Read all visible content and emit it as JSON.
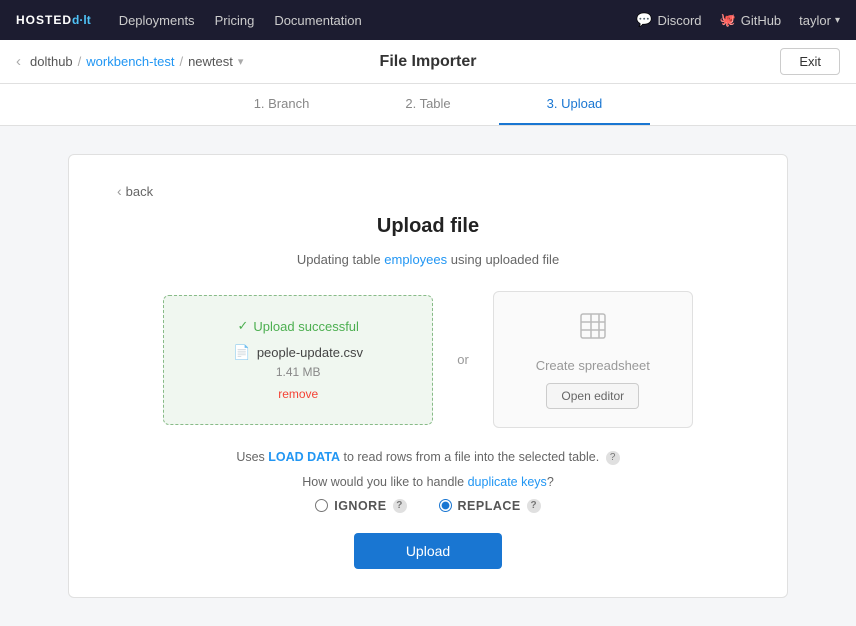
{
  "topnav": {
    "logo_hosted": "HOSTED",
    "logo_dolt": "D·LT",
    "links": [
      {
        "label": "Deployments",
        "id": "deployments"
      },
      {
        "label": "Pricing",
        "id": "pricing"
      },
      {
        "label": "Documentation",
        "id": "documentation"
      }
    ],
    "discord": "Discord",
    "github": "GitHub",
    "user": "taylor"
  },
  "subnav": {
    "breadcrumb": {
      "org": "dolthub",
      "repo": "workbench-test",
      "branch": "newtest"
    },
    "page_title": "File Importer",
    "exit_label": "Exit"
  },
  "stepper": {
    "steps": [
      {
        "label": "1. Branch",
        "state": "done"
      },
      {
        "label": "2. Table",
        "state": "done"
      },
      {
        "label": "3. Upload",
        "state": "active"
      }
    ]
  },
  "main": {
    "back_label": "back",
    "title": "Upload file",
    "subtitle_prefix": "Updating table ",
    "table_name": "employees",
    "subtitle_suffix": " using uploaded file",
    "upload_box": {
      "success_label": "Upload successful",
      "filename": "people-update.csv",
      "filesize": "1.41 MB",
      "remove_label": "remove"
    },
    "or_label": "or",
    "create_box": {
      "icon": "⊞",
      "label": "Create spreadsheet",
      "open_editor_label": "Open editor"
    },
    "load_data_text": "Uses ",
    "load_data_link": "LOAD DATA",
    "load_data_suffix": " to read rows from a file into the selected table.",
    "dup_keys_prefix": "How would you like to handle ",
    "dup_keys_link": "duplicate keys",
    "dup_keys_suffix": "?",
    "options": [
      {
        "id": "ignore",
        "label": "IGNORE",
        "checked": false
      },
      {
        "id": "replace",
        "label": "REPLACE",
        "checked": true
      }
    ],
    "upload_btn_label": "Upload"
  }
}
